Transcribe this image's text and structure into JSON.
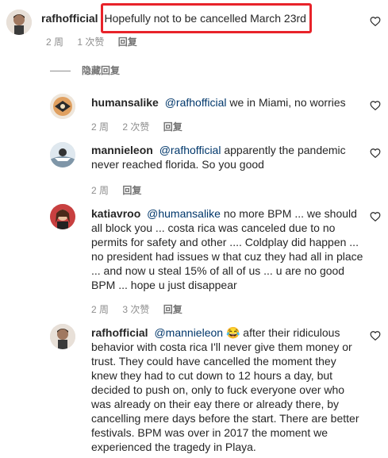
{
  "comments": [
    {
      "username": "rafhofficial",
      "text": "Hopefully not to be cancelled March 23rd",
      "time": "2 周",
      "likes": "1 次赞",
      "reply": "回复"
    },
    {
      "username": "humansalike",
      "mention": "@rafhofficial",
      "text": " we in Miami, no worries",
      "time": "2 周",
      "likes": "2 次赞",
      "reply": "回复"
    },
    {
      "username": "mannieleon",
      "mention": "@rafhofficial",
      "text": " apparently the pandemic never reached florida. So you good",
      "time": "2 周",
      "reply": "回复"
    },
    {
      "username": "katiavroo",
      "mention": "@humansalike",
      "text": " no more BPM ... we should all block you ... costa rica was canceled due to no permits for safety and other .... Coldplay did happen ... no president had issues w that cuz they had all in place ... and now u steal 15% of all of us ... u are no good BPM ... hope u just disappear",
      "time": "2 周",
      "likes": "3 次赞",
      "reply": "回复"
    },
    {
      "username": "rafhofficial",
      "mention": "@mannieleon",
      "emoji": "😂",
      "text": " after their ridiculous behavior with costa rica I'll never give them money or trust. They could have cancelled the moment they knew they had to cut down to 12 hours a day, but decided to push on, only to fuck everyone over who was already on their eay there or already there, by cancelling mere days before the start. There are better festivals. BPM was over in 2017 the moment we experienced the tragedy in Playa."
    }
  ],
  "hidden_replies_label": "隐藏回复"
}
